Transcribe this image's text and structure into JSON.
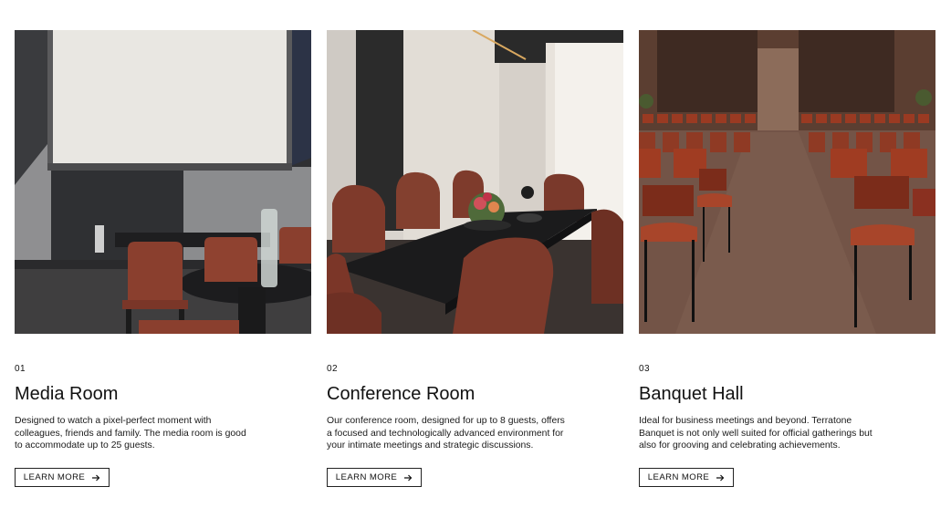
{
  "rooms": [
    {
      "number": "01",
      "title": "Media Room",
      "description": "Designed to watch a pixel-perfect moment with colleagues, friends and family. The media room is good to accommodate up to 25 guests.",
      "button_label": "LEARN MORE",
      "button_icon": "arrow-right-icon"
    },
    {
      "number": "02",
      "title": "Conference Room",
      "description": "Our conference room, designed for up to 8 guests, offers a focused and technologically advanced environment for your intimate meetings and strategic discussions.",
      "button_label": "LEARN MORE",
      "button_icon": "arrow-right-icon"
    },
    {
      "number": "03",
      "title": "Banquet Hall",
      "description": "Ideal for business meetings and beyond. Terratone Banquet is not only well suited for official gatherings but also for grooving and celebrating achievements.",
      "button_label": "LEARN MORE",
      "button_icon": "arrow-right-icon"
    }
  ],
  "colors": {
    "text": "#111111",
    "border": "#222222",
    "chair_leather": "#8a3f2e",
    "background": "#ffffff"
  }
}
